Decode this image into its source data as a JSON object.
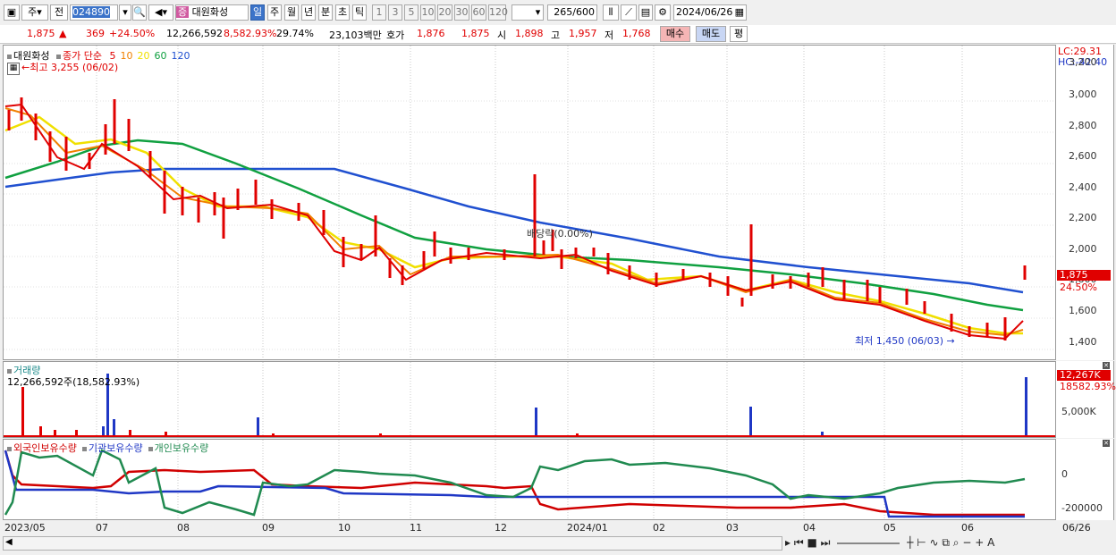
{
  "toolbar": {
    "market": "주",
    "prev_label": "전",
    "stock_code": "024890",
    "stock_name": "대원화성",
    "name_badge": "증",
    "periods": [
      "일",
      "주",
      "월",
      "년",
      "분",
      "초",
      "틱"
    ],
    "period_selected": "일",
    "minutes": [
      "1",
      "3",
      "5",
      "10",
      "20",
      "30",
      "60",
      "120"
    ],
    "count": "265",
    "count_total": "/600",
    "date": "2024/06/26"
  },
  "quote": {
    "price": "1,875",
    "change": "369",
    "change_pct": "+24.50%",
    "volume": "12,266,592",
    "volume_pct": "8,582.93%",
    "turnover": "29.74%",
    "amount": "23,103백만",
    "hoga_label": "호가",
    "ask": "1,876",
    "bid": "1,875",
    "open_label": "시",
    "open": "1,898",
    "high_label": "고",
    "high": "1,957",
    "low_label": "저",
    "low": "1,768",
    "buy_label": "매수",
    "sell_label": "매도",
    "avg_label": "평"
  },
  "price_panel": {
    "stock_name": "대원화성",
    "ma_title": "종가 단순",
    "ma_periods": [
      "5",
      "10",
      "20",
      "60",
      "120"
    ],
    "ma_colors": [
      "#e00000",
      "#f08000",
      "#f0e000",
      "#10a040",
      "#2050d0"
    ],
    "high_note": "최고 3,255 (06/02)",
    "low_note": "최저 1,450 (06/03)",
    "dividend_note": "배당락(0.00%)",
    "lc": "LC:29.31",
    "hc": "HC:-42.40",
    "y_ticks": [
      "3,200",
      "3,000",
      "2,800",
      "2,600",
      "2,400",
      "2,200",
      "2,000",
      "1,800",
      "1,600",
      "1,400"
    ],
    "current_price_tag": "1,875",
    "current_pct_tag": "24.50%"
  },
  "volume_panel": {
    "title": "거래량",
    "value_text": "12,266,592주(18,582.93%)",
    "tag_value": "12,267K",
    "tag_pct": "18582.93%",
    "y_tick": "5,000K"
  },
  "holdings_panel": {
    "series": [
      {
        "name": "외국인보유수량",
        "color": "#d00000"
      },
      {
        "name": "기관보유수량",
        "color": "#1f37c5"
      },
      {
        "name": "개인보유수량",
        "color": "#208a50"
      }
    ],
    "y_ticks": [
      "0",
      "-200000"
    ]
  },
  "x_axis": [
    "2023/05",
    "07",
    "08",
    "09",
    "10",
    "11",
    "12",
    "2024/01",
    "02",
    "03",
    "04",
    "05",
    "06",
    "06/26"
  ]
}
